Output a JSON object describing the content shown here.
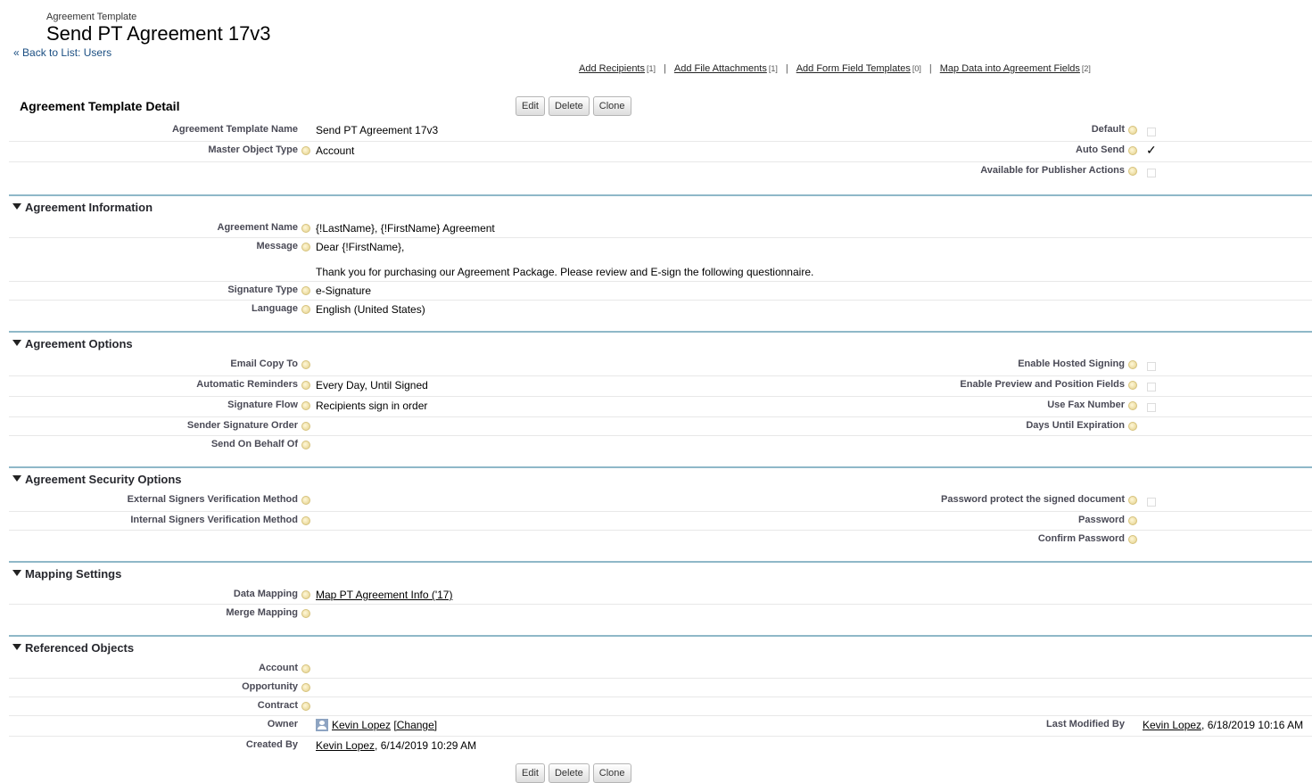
{
  "header": {
    "object_type": "Agreement Template",
    "title": "Send PT Agreement 17v3",
    "back_prefix": "«",
    "back_link": "Back to List: Users"
  },
  "related_links": [
    {
      "label": "Add Recipients",
      "count": "[1]"
    },
    {
      "label": "Add File Attachments",
      "count": "[1]"
    },
    {
      "label": "Add Form Field Templates",
      "count": "[0]"
    },
    {
      "label": "Map Data into Agreement Fields",
      "count": "[2]"
    }
  ],
  "related_sep": "|",
  "detail": {
    "title": "Agreement Template Detail",
    "edit": "Edit",
    "delete": "Delete",
    "clone": "Clone",
    "template_name_label": "Agreement Template Name",
    "template_name": "Send PT Agreement 17v3",
    "master_object_label": "Master Object Type",
    "master_object": "Account",
    "default_label": "Default",
    "default_checked": false,
    "auto_send_label": "Auto Send",
    "auto_send_mark": "✓",
    "publisher_label": "Available for Publisher Actions",
    "publisher_checked": false
  },
  "agreement_info": {
    "title": "Agreement Information",
    "name_label": "Agreement Name",
    "name": "{!LastName}, {!FirstName} Agreement",
    "message_label": "Message",
    "message_line1": "Dear {!FirstName},",
    "message_line2": "Thank you for purchasing our Agreement Package. Please review and E-sign the following questionnaire.",
    "sigtype_label": "Signature Type",
    "sigtype": "e-Signature",
    "language_label": "Language",
    "language": "English (United States)"
  },
  "agreement_options": {
    "title": "Agreement Options",
    "email_copy_label": "Email Copy To",
    "reminders_label": "Automatic Reminders",
    "reminders": "Every Day, Until Signed",
    "flow_label": "Signature Flow",
    "flow": "Recipients sign in order",
    "sender_order_label": "Sender Signature Order",
    "behalf_label": "Send On Behalf Of",
    "hosted_label": "Enable Hosted Signing",
    "preview_label": "Enable Preview and Position Fields",
    "fax_label": "Use Fax Number",
    "expiration_label": "Days Until Expiration"
  },
  "security": {
    "title": "Agreement Security Options",
    "external_label": "External Signers Verification Method",
    "internal_label": "Internal Signers Verification Method",
    "protect_label": "Password protect the signed document",
    "password_label": "Password",
    "confirm_label": "Confirm Password"
  },
  "mapping": {
    "title": "Mapping Settings",
    "data_label": "Data Mapping",
    "data_value": "Map PT Agreement Info ('17)",
    "merge_label": "Merge Mapping"
  },
  "referenced": {
    "title": "Referenced Objects",
    "account_label": "Account",
    "opportunity_label": "Opportunity",
    "contract_label": "Contract",
    "owner_label": "Owner",
    "owner_name": "Kevin Lopez",
    "owner_change": "[Change]",
    "created_label": "Created By",
    "created_name": "Kevin Lopez",
    "created_date": ", 6/14/2019 10:29 AM",
    "modified_label": "Last Modified By",
    "modified_name": "Kevin Lopez",
    "modified_date": ", 6/18/2019 10:16 AM"
  }
}
